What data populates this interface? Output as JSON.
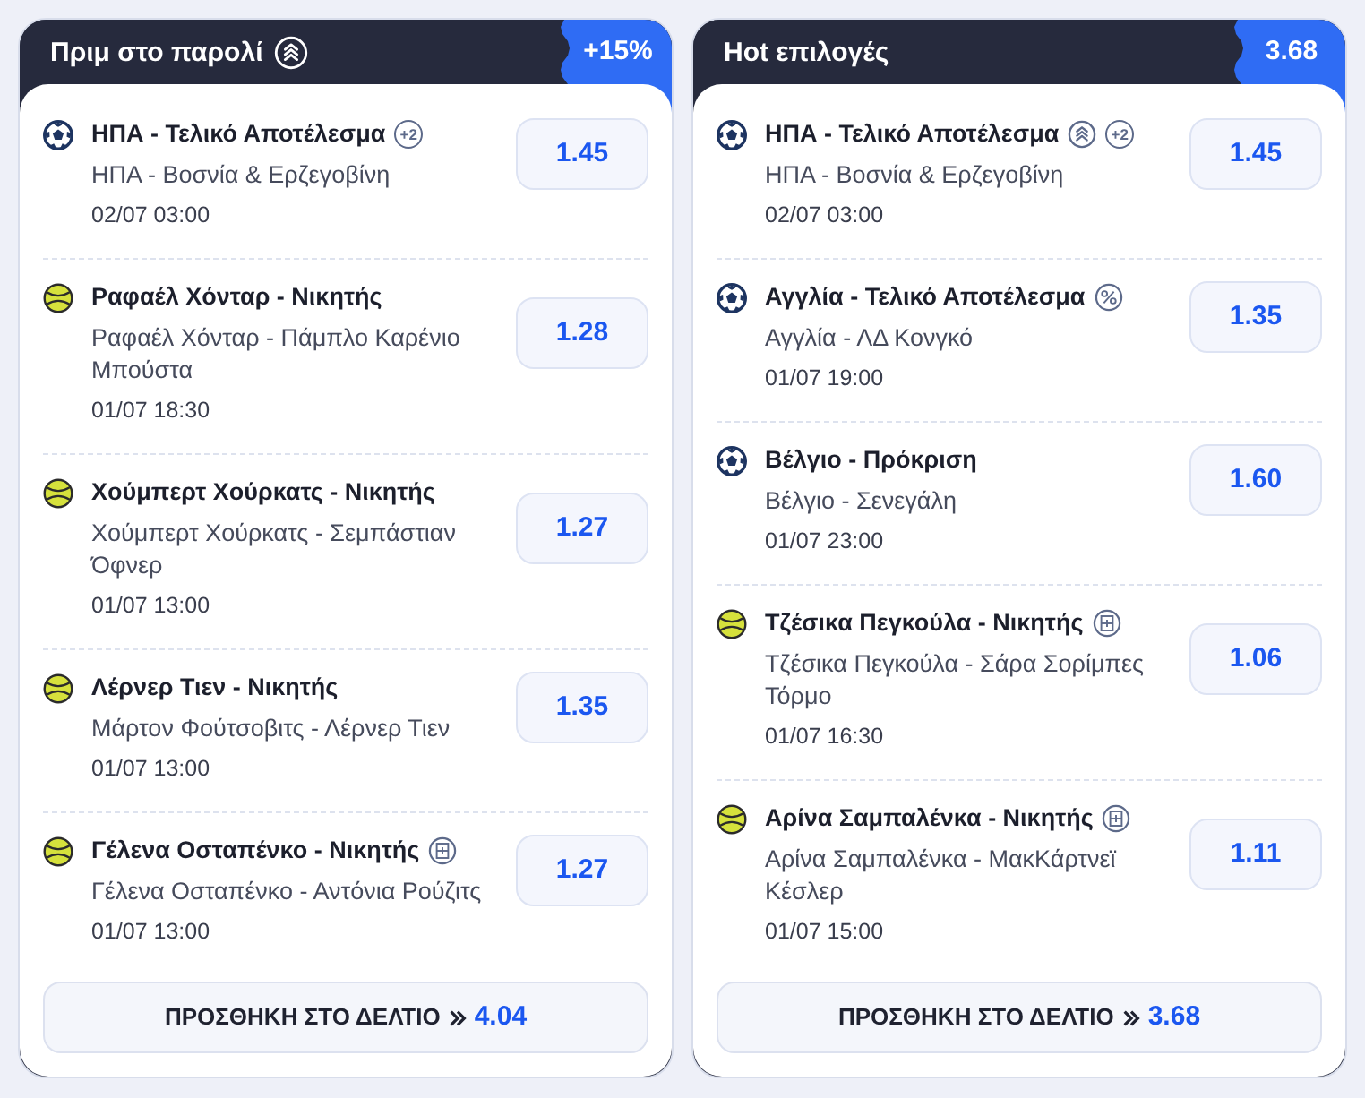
{
  "panels": [
    {
      "title": "Πριμ στο παρολί",
      "boosted": true,
      "badge": "+15%",
      "rows": [
        {
          "kind": "soccer",
          "market": "ΗΠΑ - Τελικό Αποτέλεσμα",
          "tags": [
            {
              "kind": "count",
              "text": "+2"
            }
          ],
          "event": "ΗΠΑ - Βοσνία & Ερζεγοβίνη",
          "time": "02/07 03:00",
          "odds": "1.45"
        },
        {
          "kind": "tennis",
          "market": "Ραφαέλ Χόνταρ - Νικητής",
          "tags": [],
          "event": "Ραφαέλ Χόνταρ - Πάμπλο Καρένιο Μπούστα",
          "time": "01/07 18:30",
          "odds": "1.28"
        },
        {
          "kind": "tennis",
          "market": "Χούμπερτ Χούρκατς - Νικητής",
          "tags": [],
          "event": "Χούμπερτ Χούρκατς - Σεμπάστιαν Όφνερ",
          "time": "01/07 13:00",
          "odds": "1.27"
        },
        {
          "kind": "tennis",
          "market": "Λέρνερ Τιεν - Νικητής",
          "tags": [],
          "event": "Μάρτον Φούτσοβιτς - Λέρνερ Τιεν",
          "time": "01/07 13:00",
          "odds": "1.35"
        },
        {
          "kind": "tennis",
          "market": "Γέλενα Οσταπένκο - Νικητής",
          "tags": [
            {
              "kind": "court"
            }
          ],
          "event": "Γέλενα Οσταπένκο - Αντόνια Ρούζιτς",
          "time": "01/07 13:00",
          "odds": "1.27"
        }
      ],
      "add_button": {
        "label": "ΠΡΟΣΘΗΚΗ ΣΤΟ ΔΕΛΤΙΟ",
        "total": "4.04"
      }
    },
    {
      "title": "Hot επιλογές",
      "boosted": false,
      "badge": "3.68",
      "rows": [
        {
          "kind": "soccer",
          "market": "ΗΠΑ - Τελικό Αποτέλεσμα",
          "tags": [
            {
              "kind": "boost"
            },
            {
              "kind": "count",
              "text": "+2"
            }
          ],
          "event": "ΗΠΑ - Βοσνία & Ερζεγοβίνη",
          "time": "02/07 03:00",
          "odds": "1.45"
        },
        {
          "kind": "soccer",
          "market": "Αγγλία - Τελικό Αποτέλεσμα",
          "tags": [
            {
              "kind": "percent"
            }
          ],
          "event": "Αγγλία - ΛΔ Κονγκό",
          "time": "01/07 19:00",
          "odds": "1.35"
        },
        {
          "kind": "soccer",
          "market": "Βέλγιο - Πρόκριση",
          "tags": [],
          "event": "Βέλγιο - Σενεγάλη",
          "time": "01/07 23:00",
          "odds": "1.60"
        },
        {
          "kind": "tennis",
          "market": "Τζέσικα Πεγκούλα - Νικητής",
          "tags": [
            {
              "kind": "court"
            }
          ],
          "event": "Τζέσικα Πεγκούλα - Σάρα Σορίμπες Τόρμο",
          "time": "01/07 16:30",
          "odds": "1.06"
        },
        {
          "kind": "tennis",
          "market": "Αρίνα Σαμπαλένκα - Νικητής",
          "tags": [
            {
              "kind": "court"
            }
          ],
          "event": "Αρίνα Σαμπαλένκα - ΜακΚάρτνεϊ Κέσλερ",
          "time": "01/07 15:00",
          "odds": "1.11"
        }
      ],
      "add_button": {
        "label": "ΠΡΟΣΘΗΚΗ ΣΤΟ ΔΕΛΤΙΟ",
        "total": "3.68"
      }
    }
  ]
}
